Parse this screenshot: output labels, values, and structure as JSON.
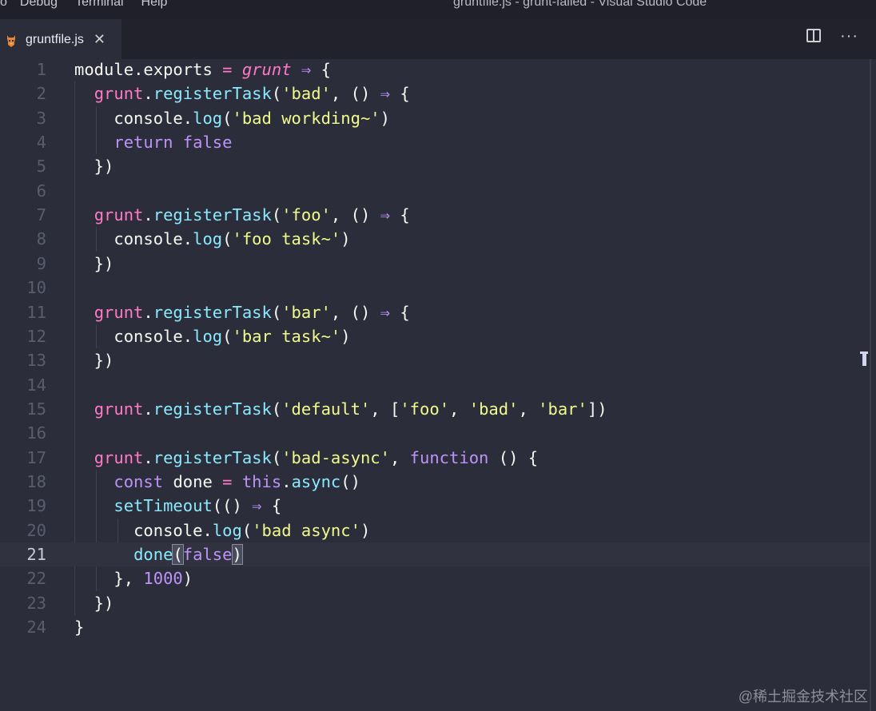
{
  "menu": {
    "items": [
      "o",
      "Debug",
      "Terminal",
      "Help"
    ]
  },
  "window_title": "gruntfile.js - grunt-failed - Visual Studio Code",
  "tab": {
    "label": "gruntfile.js",
    "close": "✕"
  },
  "actions": {
    "more": "···"
  },
  "line_numbers": [
    "1",
    "2",
    "3",
    "4",
    "5",
    "6",
    "7",
    "8",
    "9",
    "10",
    "11",
    "12",
    "13",
    "14",
    "15",
    "16",
    "17",
    "18",
    "19",
    "20",
    "21",
    "22",
    "23",
    "24"
  ],
  "code": [
    [
      [
        "t-mod",
        "module"
      ],
      [
        "t-def",
        "."
      ],
      [
        "t-exports",
        "exports"
      ],
      [
        "t-def",
        " "
      ],
      [
        "t-op",
        "="
      ],
      [
        "t-def",
        " "
      ],
      [
        "t-gi",
        "grunt"
      ],
      [
        "t-def",
        " "
      ],
      [
        "t-arrow",
        "⇒"
      ],
      [
        "t-def",
        " {"
      ]
    ],
    [
      [
        "t-def",
        "  "
      ],
      [
        "t-grunt",
        "grunt"
      ],
      [
        "t-def",
        "."
      ],
      [
        "t-prop",
        "registerTask"
      ],
      [
        "t-def",
        "("
      ],
      [
        "t-str",
        "'bad'"
      ],
      [
        "t-def",
        ", () "
      ],
      [
        "t-arrow",
        "⇒"
      ],
      [
        "t-def",
        " {"
      ]
    ],
    [
      [
        "t-def",
        "    "
      ],
      [
        "t-var",
        "console"
      ],
      [
        "t-def",
        "."
      ],
      [
        "t-prop",
        "log"
      ],
      [
        "t-def",
        "("
      ],
      [
        "t-str",
        "'bad workding~'"
      ],
      [
        "t-def",
        ")"
      ]
    ],
    [
      [
        "t-def",
        "    "
      ],
      [
        "t-kw",
        "return"
      ],
      [
        "t-def",
        " "
      ],
      [
        "t-bool",
        "false"
      ]
    ],
    [
      [
        "t-def",
        "  })"
      ]
    ],
    [],
    [
      [
        "t-def",
        "  "
      ],
      [
        "t-grunt",
        "grunt"
      ],
      [
        "t-def",
        "."
      ],
      [
        "t-prop",
        "registerTask"
      ],
      [
        "t-def",
        "("
      ],
      [
        "t-str",
        "'foo'"
      ],
      [
        "t-def",
        ", () "
      ],
      [
        "t-arrow",
        "⇒"
      ],
      [
        "t-def",
        " {"
      ]
    ],
    [
      [
        "t-def",
        "    "
      ],
      [
        "t-var",
        "console"
      ],
      [
        "t-def",
        "."
      ],
      [
        "t-prop",
        "log"
      ],
      [
        "t-def",
        "("
      ],
      [
        "t-str",
        "'foo task~'"
      ],
      [
        "t-def",
        ")"
      ]
    ],
    [
      [
        "t-def",
        "  })"
      ]
    ],
    [],
    [
      [
        "t-def",
        "  "
      ],
      [
        "t-grunt",
        "grunt"
      ],
      [
        "t-def",
        "."
      ],
      [
        "t-prop",
        "registerTask"
      ],
      [
        "t-def",
        "("
      ],
      [
        "t-str",
        "'bar'"
      ],
      [
        "t-def",
        ", () "
      ],
      [
        "t-arrow",
        "⇒"
      ],
      [
        "t-def",
        " {"
      ]
    ],
    [
      [
        "t-def",
        "    "
      ],
      [
        "t-var",
        "console"
      ],
      [
        "t-def",
        "."
      ],
      [
        "t-prop",
        "log"
      ],
      [
        "t-def",
        "("
      ],
      [
        "t-str",
        "'bar task~'"
      ],
      [
        "t-def",
        ")"
      ]
    ],
    [
      [
        "t-def",
        "  })"
      ]
    ],
    [],
    [
      [
        "t-def",
        "  "
      ],
      [
        "t-grunt",
        "grunt"
      ],
      [
        "t-def",
        "."
      ],
      [
        "t-prop",
        "registerTask"
      ],
      [
        "t-def",
        "("
      ],
      [
        "t-str",
        "'default'"
      ],
      [
        "t-def",
        ", ["
      ],
      [
        "t-str",
        "'foo'"
      ],
      [
        "t-def",
        ", "
      ],
      [
        "t-str",
        "'bad'"
      ],
      [
        "t-def",
        ", "
      ],
      [
        "t-str",
        "'bar'"
      ],
      [
        "t-def",
        "])"
      ]
    ],
    [],
    [
      [
        "t-def",
        "  "
      ],
      [
        "t-grunt",
        "grunt"
      ],
      [
        "t-def",
        "."
      ],
      [
        "t-prop",
        "registerTask"
      ],
      [
        "t-def",
        "("
      ],
      [
        "t-str",
        "'bad-async'"
      ],
      [
        "t-def",
        ", "
      ],
      [
        "t-kw",
        "function"
      ],
      [
        "t-def",
        " () {"
      ]
    ],
    [
      [
        "t-def",
        "    "
      ],
      [
        "t-kw",
        "const"
      ],
      [
        "t-def",
        " "
      ],
      [
        "t-var",
        "done"
      ],
      [
        "t-def",
        " "
      ],
      [
        "t-op",
        "="
      ],
      [
        "t-def",
        " "
      ],
      [
        "t-kw",
        "this"
      ],
      [
        "t-def",
        "."
      ],
      [
        "t-prop",
        "async"
      ],
      [
        "t-def",
        "()"
      ]
    ],
    [
      [
        "t-def",
        "    "
      ],
      [
        "t-prop",
        "setTimeout"
      ],
      [
        "t-def",
        "(() "
      ],
      [
        "t-arrow",
        "⇒"
      ],
      [
        "t-def",
        " {"
      ]
    ],
    [
      [
        "t-def",
        "      "
      ],
      [
        "t-var",
        "console"
      ],
      [
        "t-def",
        "."
      ],
      [
        "t-prop",
        "log"
      ],
      [
        "t-def",
        "("
      ],
      [
        "t-str",
        "'bad async'"
      ],
      [
        "t-def",
        ")"
      ]
    ],
    [
      [
        "t-def",
        "      "
      ],
      [
        "t-prop",
        "done"
      ],
      [
        "t-def hl",
        "("
      ],
      [
        "t-bool",
        "false"
      ],
      [
        "t-def hl",
        ")"
      ]
    ],
    [
      [
        "t-def",
        "    }, "
      ],
      [
        "t-num",
        "1000"
      ],
      [
        "t-def",
        ")"
      ]
    ],
    [
      [
        "t-def",
        "  })"
      ]
    ],
    [
      [
        "t-def",
        "}"
      ]
    ]
  ],
  "colors": {
    "editor_bg": "#2b2d3a",
    "string": "#f1fa8c",
    "keyword": "#bd93f9",
    "function": "#8be9fd",
    "grunt": "#ff79c6"
  },
  "watermark": "@稀土掘金技术社区"
}
